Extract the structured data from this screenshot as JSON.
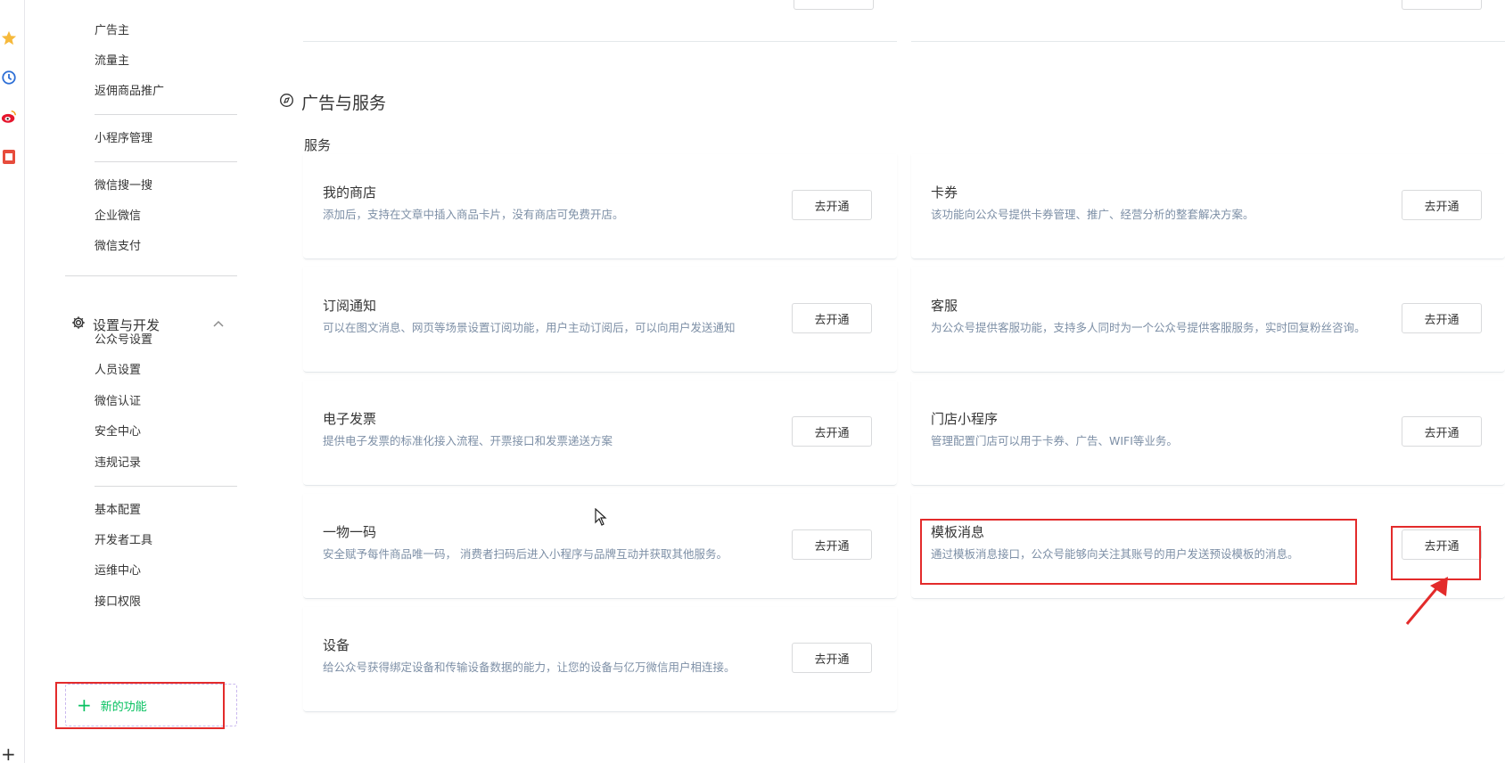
{
  "sidebar": {
    "ad_items": [
      "广告主",
      "流量主",
      "返佣商品推广"
    ],
    "miniprogram_items": [
      "小程序管理"
    ],
    "wechat_items": [
      "微信搜一搜",
      "企业微信",
      "微信支付"
    ],
    "settings_group": {
      "label": "设置与开发",
      "icon": "gear-icon",
      "items": [
        "公众号设置",
        "人员设置",
        "微信认证",
        "安全中心",
        "违规记录"
      ],
      "dev_items": [
        "基本配置",
        "开发者工具",
        "运维中心",
        "接口权限"
      ]
    },
    "new_feature": {
      "label": "新的功能",
      "icon": "plus-icon"
    }
  },
  "strip_icons": [
    "star-icon",
    "history-icon",
    "weibo-icon",
    "pdf-icon"
  ],
  "main": {
    "section_title": "广告与服务",
    "section_icon": "compass-icon",
    "subheading": "服务",
    "button_label": "去开通",
    "cards": [
      {
        "title": "我的商店",
        "desc": "添加后，支持在文章中插入商品卡片，没有商店可免费开店。"
      },
      {
        "title": "卡券",
        "desc": "该功能向公众号提供卡券管理、推广、经营分析的整套解决方案。"
      },
      {
        "title": "订阅通知",
        "desc": "可以在图文消息、网页等场景设置订阅功能，用户主动订阅后，可以向用户发送通知"
      },
      {
        "title": "客服",
        "desc": "为公众号提供客服功能，支持多人同时为一个公众号提供客服服务，实时回复粉丝咨询。"
      },
      {
        "title": "电子发票",
        "desc": "提供电子发票的标准化接入流程、开票接口和发票递送方案"
      },
      {
        "title": "门店小程序",
        "desc": "管理配置门店可以用于卡券、广告、WIFI等业务。"
      },
      {
        "title": "一物一码",
        "desc": "安全赋予每件商品唯一码， 消费者扫码后进入小程序与品牌互动并获取其他服务。"
      },
      {
        "title": "模板消息",
        "desc": "通过模板消息接口，公众号能够向关注其账号的用户发送预设模板的消息。"
      },
      {
        "title": "设备",
        "desc": "给公众号获得绑定设备和传输设备数据的能力，让您的设备与亿万微信用户相连接。"
      }
    ]
  },
  "colors": {
    "accent_green": "#07c160",
    "highlight_red": "#e32b2b",
    "desc_gray": "#7d8fa6"
  }
}
